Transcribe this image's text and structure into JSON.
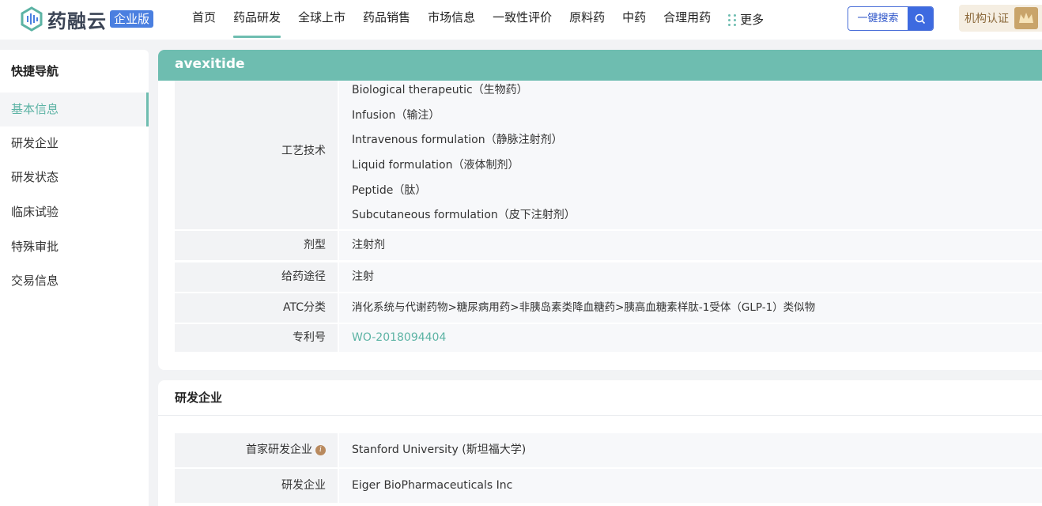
{
  "brand": {
    "name": "药融云",
    "edition": "企业版"
  },
  "nav": {
    "items": [
      "首页",
      "药品研发",
      "全球上市",
      "药品销售",
      "市场信息",
      "一致性评价",
      "原料药",
      "中药",
      "合理用药"
    ],
    "active_index": 1,
    "more_label": "更多"
  },
  "search": {
    "label": "一键搜索"
  },
  "cert": {
    "label": "机构认证"
  },
  "sidebar": {
    "title": "快捷导航",
    "items": [
      "基本信息",
      "研发企业",
      "研发状态",
      "临床试验",
      "特殊审批",
      "交易信息"
    ],
    "active_index": 0
  },
  "drug": {
    "name": "avexitide",
    "tech_label": "工艺技术",
    "tech_values": [
      "Biological therapeutic（生物药）",
      "Infusion（输注）",
      "Intravenous formulation（静脉注射剂）",
      "Liquid formulation（液体制剂）",
      "Peptide（肽）",
      "Subcutaneous formulation（皮下注射剂）"
    ],
    "fields": [
      {
        "label": "剂型",
        "value": "注射剂"
      },
      {
        "label": "给药途径",
        "value": "注射"
      },
      {
        "label": "ATC分类",
        "value": "消化系统与代谢药物>糖尿病用药>非胰岛素类降血糖药>胰高血糖素样肽-1受体（GLP-1）类似物"
      },
      {
        "label": "专利号",
        "value": "WO-2018094404"
      }
    ]
  },
  "rd_section": {
    "title": "研发企业",
    "first_label": "首家研发企业",
    "first_value": "Stanford University (斯坦福大学)",
    "company_label": "研发企业",
    "company_value": "Eiger BioPharmaceuticals Inc"
  },
  "colors": {
    "accent": "#6ebdb0",
    "brand_blue": "#3d6ae0"
  }
}
